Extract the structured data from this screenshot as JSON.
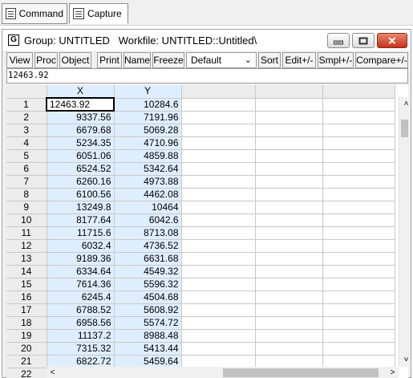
{
  "tabs": [
    {
      "label": "Command",
      "icon": "command-window-icon"
    },
    {
      "label": "Capture",
      "icon": "capture-window-icon"
    }
  ],
  "window": {
    "icon_letter": "G",
    "title": "Group: UNTITLED   Workfile: UNTITLED::Untitled\\"
  },
  "toolbar": {
    "view": "View",
    "proc": "Proc",
    "object": "Object",
    "print": "Print",
    "name": "Name",
    "freeze": "Freeze",
    "display_format": "Default",
    "sort": "Sort",
    "edit": "Edit+/-",
    "smpl": "Smpl+/-",
    "compare": "Compare+/-"
  },
  "edit_line": "12463.92",
  "columns": [
    "X",
    "Y"
  ],
  "rows": [
    {
      "n": "1",
      "x": "12463.92",
      "y": "10284.6"
    },
    {
      "n": "2",
      "x": "9337.56",
      "y": "7191.96"
    },
    {
      "n": "3",
      "x": "6679.68",
      "y": "5069.28"
    },
    {
      "n": "4",
      "x": "5234.35",
      "y": "4710.96"
    },
    {
      "n": "5",
      "x": "6051.06",
      "y": "4859.88"
    },
    {
      "n": "6",
      "x": "6524.52",
      "y": "5342.64"
    },
    {
      "n": "7",
      "x": "6260.16",
      "y": "4973.88"
    },
    {
      "n": "8",
      "x": "6100.56",
      "y": "4462.08"
    },
    {
      "n": "9",
      "x": "13249.8",
      "y": "10464"
    },
    {
      "n": "10",
      "x": "8177.64",
      "y": "6042.6"
    },
    {
      "n": "11",
      "x": "11715.6",
      "y": "8713.08"
    },
    {
      "n": "12",
      "x": "6032.4",
      "y": "4736.52"
    },
    {
      "n": "13",
      "x": "9189.36",
      "y": "6631.68"
    },
    {
      "n": "14",
      "x": "6334.64",
      "y": "4549.32"
    },
    {
      "n": "15",
      "x": "7614.36",
      "y": "5596.32"
    },
    {
      "n": "16",
      "x": "6245.4",
      "y": "4504.68"
    },
    {
      "n": "17",
      "x": "6788.52",
      "y": "5608.92"
    },
    {
      "n": "18",
      "x": "6958.56",
      "y": "5574.72"
    },
    {
      "n": "19",
      "x": "11137.2",
      "y": "8988.48"
    },
    {
      "n": "20",
      "x": "7315.32",
      "y": "5413.44"
    },
    {
      "n": "21",
      "x": "6822.72",
      "y": "5459.64"
    },
    {
      "n": "22",
      "x": "",
      "y": ""
    }
  ]
}
